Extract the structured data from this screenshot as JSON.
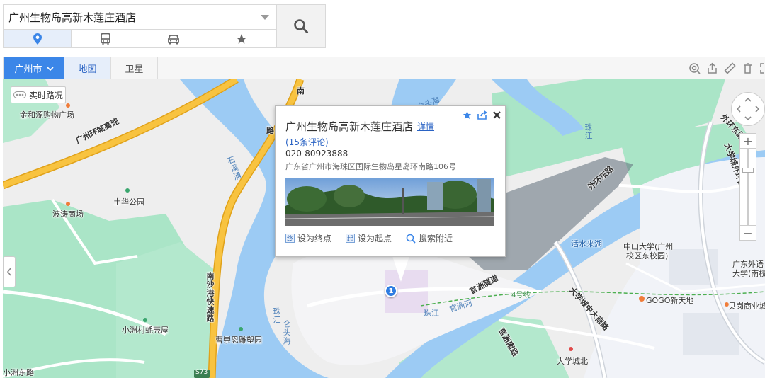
{
  "search": {
    "value": "广州生物岛高新木莲庄酒店",
    "modes": [
      {
        "icon": "location-pin-icon",
        "active": true
      },
      {
        "icon": "bus-icon",
        "active": false
      },
      {
        "icon": "car-icon",
        "active": false
      },
      {
        "icon": "star-icon",
        "active": false
      }
    ]
  },
  "toolbar": {
    "city": "广州市",
    "map_tab": "地图",
    "satellite_tab": "卫星"
  },
  "map": {
    "traffic_button": "实时路况",
    "marker_number": "1",
    "labels": {
      "jinhe": "金和源购物广场",
      "ring_expressway": "广州环城高速",
      "tuhua_park": "土华公园",
      "botao": "波涛商场",
      "nansha_port": "南沙港快速路",
      "xiaozhou_village": "小洲村蚝壳屋",
      "caochong": "曹崇恩雕塑园",
      "xiaozhou_east": "小洲东路",
      "s73": "S73",
      "shixi": "石溪涌",
      "nan": "南",
      "lu": "路",
      "zhujiang1": "珠江",
      "zhujiang2": "珠江",
      "lantou": "仑头海",
      "lantou2": "仑头海",
      "guanzhou_tunnel": "官洲隧道",
      "guanzhou_river": "官洲河",
      "zhujiang3": "珠江",
      "metro4": "4号线",
      "waihuan_east": "外环东路",
      "huoshui": "活水来湖",
      "zsu": "中山大学(广州",
      "zsu2": "校区东校园)",
      "daxuecheng_central": "大学城中大南路",
      "gogo": "GOGO新天地",
      "guanzhou_road": "官洲南路",
      "daxuecheng_north": "大学城北",
      "gdwaiyu": "广东外语",
      "gdwaiyu2": "大学(南校",
      "beigang": "贝岗商业城",
      "daxuecheng_outer": "大学城外环西路",
      "huangdong": "外环东路"
    }
  },
  "info_window": {
    "title": "广州生物岛高新木莲庄酒店",
    "detail_link": "详情",
    "reviews": "(15条评论)",
    "phone": "020-80923888",
    "address": "广东省广州市海珠区国际生物岛星岛环南路106号",
    "actions": {
      "set_end": "设为终点",
      "set_start": "设为起点",
      "search_nearby": "搜索附近"
    }
  },
  "colors": {
    "water": "#9ccbf4",
    "green": "#aae5c7",
    "land": "#efefef",
    "expressway": "#f8c340",
    "accent": "#3b86e8"
  }
}
